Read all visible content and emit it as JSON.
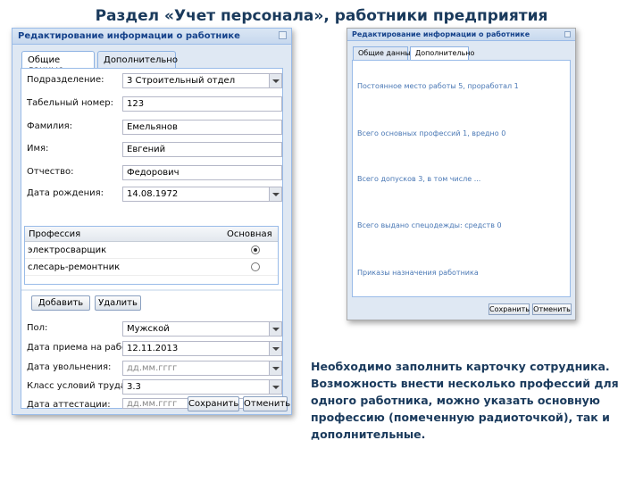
{
  "slide": {
    "title": "Раздел «Учет персонала», работники предприятия",
    "description": "Необходимо заполнить карточку сотрудника. Возможность внести несколько профессий для одного работника, можно указать основную профессию (помеченную радиоточкой), так и дополнительные."
  },
  "left_dialog": {
    "title": "Редактирование информации о работнике",
    "tabs": [
      "Общие данные",
      "Дополнительно"
    ],
    "fields": {
      "department": {
        "label": "Подразделение:",
        "value": "3 Строительный отдел"
      },
      "tab_number": {
        "label": "Табельный номер:",
        "value": "123"
      },
      "surname": {
        "label": "Фамилия:",
        "value": "Емельянов"
      },
      "name": {
        "label": "Имя:",
        "value": "Евгений"
      },
      "patronymic": {
        "label": "Отчество:",
        "value": "Федорович"
      },
      "birth_date": {
        "label": "Дата рождения:",
        "value": "14.08.1972"
      },
      "sex": {
        "label": "Пол:",
        "value": "Мужской"
      },
      "hire_date": {
        "label": "Дата приема на работу:",
        "value": "12.11.2013"
      },
      "dismissal_date": {
        "label": "Дата увольнения:",
        "value": "дд.мм.гггг"
      },
      "work_class": {
        "label": "Класс условий труда:",
        "value": "3.3"
      },
      "attestation_date": {
        "label": "Дата аттестации:",
        "value": "дд.мм.гггг"
      }
    },
    "grid": {
      "columns": [
        "Профессия",
        "Основная"
      ],
      "rows": [
        {
          "profession": "электросварщик",
          "main": true
        },
        {
          "profession": "слесарь-ремонтник",
          "main": false
        }
      ]
    },
    "buttons": {
      "add": "Добавить",
      "delete": "Удалить",
      "save": "Сохранить",
      "cancel": "Отменить"
    }
  },
  "right_dialog": {
    "title": "Редактирование информации о работнике",
    "tabs": [
      "Общие данные",
      "Дополнительно"
    ],
    "links": [
      "Постоянное место работы 5, проработал 1",
      "Всего основных профессий 1, вредно 0",
      "Всего допусков 3, в том числе ...",
      "Всего выдано спецодежды: средств 0",
      "Приказы назначения работника"
    ],
    "buttons": {
      "save": "Сохранить",
      "cancel": "Отменить"
    }
  }
}
